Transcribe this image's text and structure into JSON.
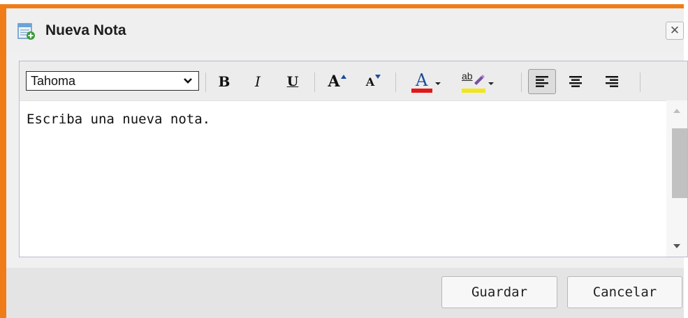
{
  "dialog": {
    "title": "Nueva Nota",
    "close_label": "✕"
  },
  "toolbar": {
    "font": "Tahoma",
    "bold_label": "B",
    "italic_label": "I",
    "underline_label": "U",
    "grow_label": "A",
    "shrink_label": "A",
    "font_color_label": "A",
    "font_color": "#e11919",
    "highlight_label": "ab",
    "highlight_color": "#f1e61c"
  },
  "editor": {
    "content": "Escriba una nueva nota."
  },
  "buttons": {
    "save_label": "Guardar",
    "cancel_label": "Cancelar"
  },
  "colors": {
    "frame": "#f07c18"
  }
}
